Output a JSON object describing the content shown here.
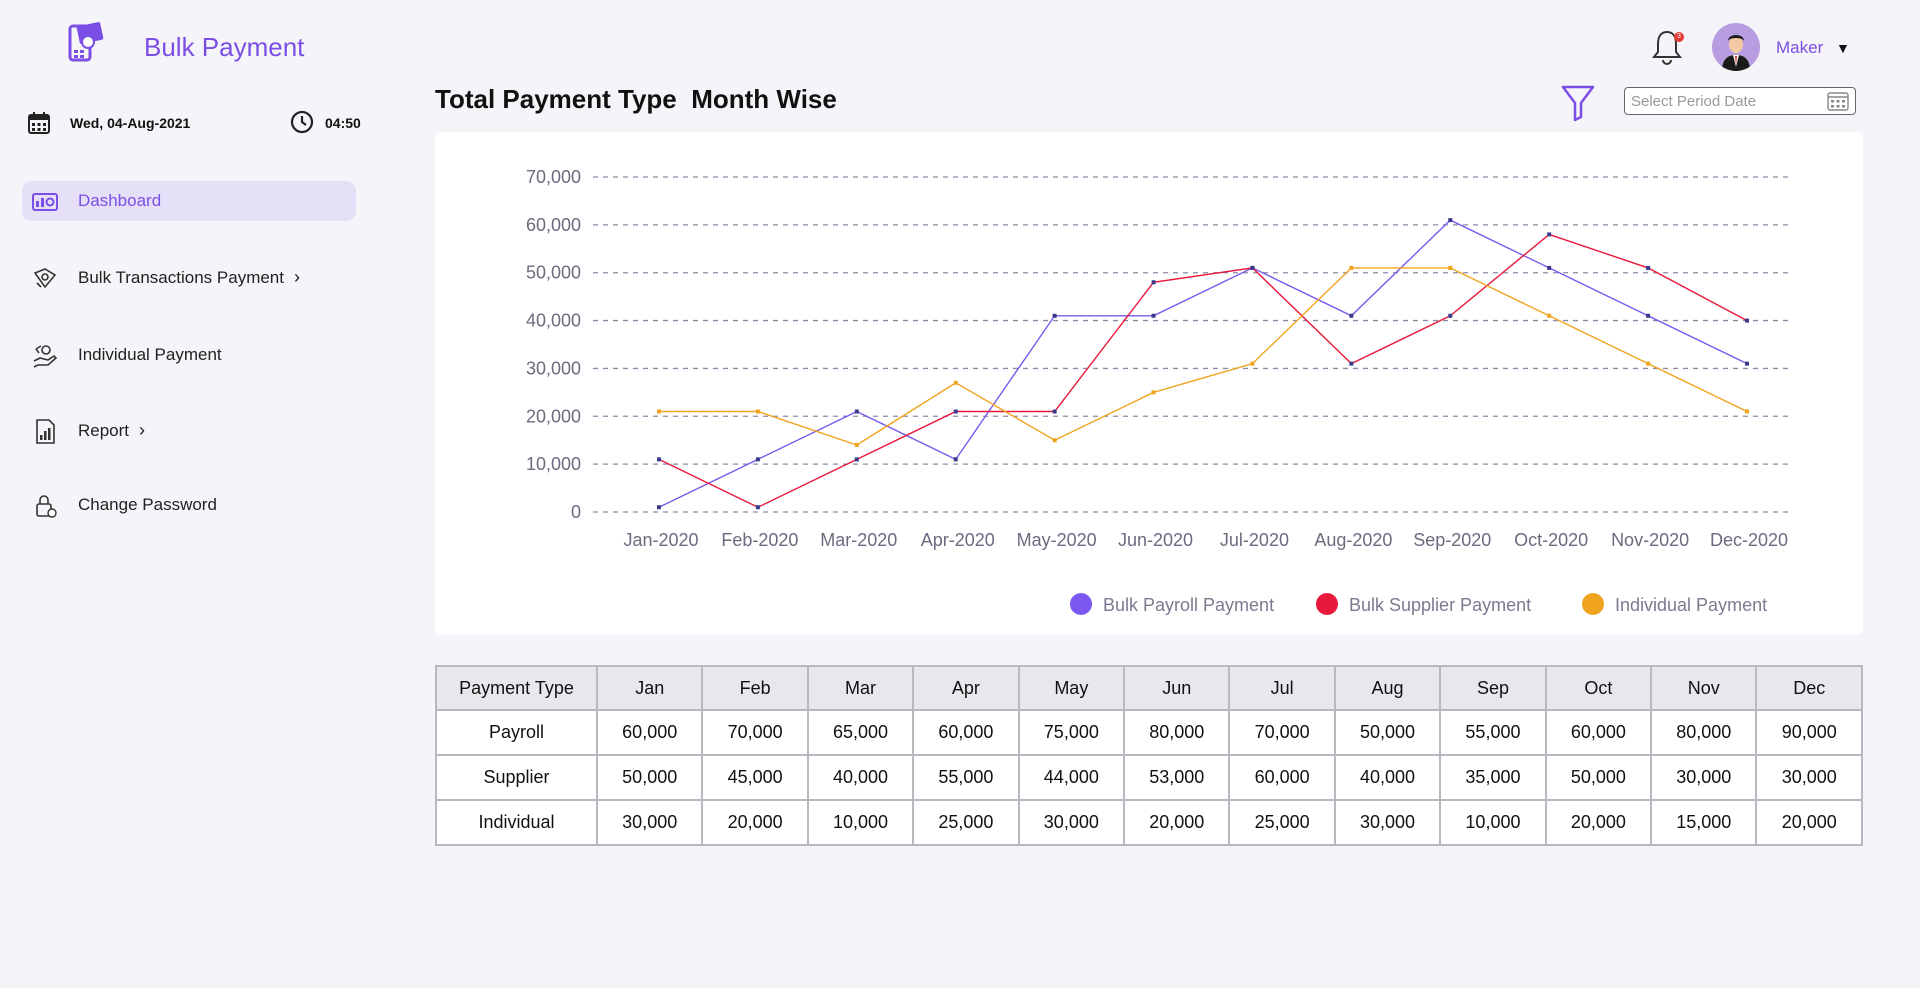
{
  "app": {
    "title": "Bulk Payment"
  },
  "datetime": {
    "date": "Wed, 04-Aug-2021",
    "time": "04:50"
  },
  "sidebar": {
    "items": [
      {
        "label": "Dashboard",
        "icon": "dashboard-icon",
        "active": true,
        "has_chevron": false
      },
      {
        "label": "Bulk Transactions Payment",
        "icon": "transactions-icon",
        "active": false,
        "has_chevron": true
      },
      {
        "label": "Individual Payment",
        "icon": "hand-money-icon",
        "active": false,
        "has_chevron": false
      },
      {
        "label": "Report",
        "icon": "report-icon",
        "active": false,
        "has_chevron": true
      },
      {
        "label": "Change Password",
        "icon": "lock-icon",
        "active": false,
        "has_chevron": false
      }
    ],
    "chevron": "›"
  },
  "header": {
    "notification_count": "3",
    "user_name": "Maker",
    "caret": "▼"
  },
  "page": {
    "title": "Total Payment Type  Month Wise",
    "period_placeholder": "Select Period Date"
  },
  "colors": {
    "accent": "#7b4ee6",
    "payroll": "#7b59f0",
    "supplier": "#e8193c",
    "individual": "#f0a31e"
  },
  "chart_data": {
    "type": "line",
    "categories": [
      "Jan-2020",
      "Feb-2020",
      "Mar-2020",
      "Apr-2020",
      "May-2020",
      "Jun-2020",
      "Jul-2020",
      "Aug-2020",
      "Sep-2020",
      "Oct-2020",
      "Nov-2020",
      "Dec-2020"
    ],
    "ylim": [
      0,
      70000
    ],
    "yticks": [
      "70,000",
      "60,000",
      "50,000",
      "40,000",
      "30,000",
      "20,000",
      "10,000",
      "0"
    ],
    "ytick_values": [
      70000,
      60000,
      50000,
      40000,
      30000,
      20000,
      10000,
      0
    ],
    "grid": "dashed horizontal",
    "legend_position": "bottom-right",
    "series": [
      {
        "name": "Bulk Payroll Payment",
        "color": "#7b59f0",
        "values": [
          1000,
          11000,
          21000,
          11000,
          41000,
          41000,
          51000,
          41000,
          61000,
          51000,
          41000,
          31000
        ]
      },
      {
        "name": "Bulk Supplier Payment",
        "color": "#e8193c",
        "values": [
          11000,
          1000,
          11000,
          21000,
          21000,
          48000,
          51000,
          31000,
          41000,
          58000,
          51000,
          40000
        ]
      },
      {
        "name": "Individual Payment",
        "color": "#f0a31e",
        "values": [
          21000,
          21000,
          14000,
          27000,
          15000,
          25000,
          31000,
          51000,
          51000,
          41000,
          31000,
          21000
        ]
      }
    ]
  },
  "table": {
    "headers": [
      "Payment  Type",
      "Jan",
      "Feb",
      "Mar",
      "Apr",
      "May",
      "Jun",
      "Jul",
      "Aug",
      "Sep",
      "Oct",
      "Nov",
      "Dec"
    ],
    "rows": [
      [
        "Payroll",
        "60,000",
        "70,000",
        "65,000",
        "60,000",
        "75,000",
        "80,000",
        "70,000",
        "50,000",
        "55,000",
        "60,000",
        "80,000",
        "90,000"
      ],
      [
        "Supplier",
        "50,000",
        "45,000",
        "40,000",
        "55,000",
        "44,000",
        "53,000",
        "60,000",
        "40,000",
        "35,000",
        "50,000",
        "30,000",
        "30,000"
      ],
      [
        "Individual",
        "30,000",
        "20,000",
        "10,000",
        "25,000",
        "30,000",
        "20,000",
        "25,000",
        "30,000",
        "10,000",
        "20,000",
        "15,000",
        "20,000"
      ]
    ]
  }
}
